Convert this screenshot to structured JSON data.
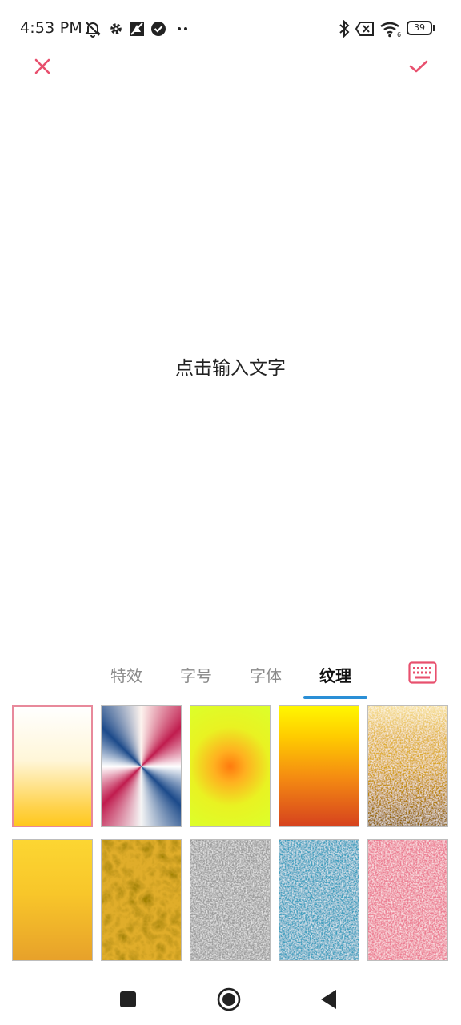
{
  "status_bar": {
    "time": "4:53 PM",
    "battery": "39",
    "icons": [
      "muted-bell-icon",
      "gear-icon",
      "sync-icon",
      "check-circle-icon",
      "more-dots-icon",
      "bluetooth-icon",
      "no-sim-icon",
      "wifi-icon",
      "battery-icon"
    ]
  },
  "header": {
    "close_icon": "close-icon",
    "confirm_icon": "check-icon",
    "accent_color": "#e8506e"
  },
  "canvas": {
    "placeholder": "点击输入文字"
  },
  "tabs": {
    "items": [
      {
        "label": "特效",
        "active": false
      },
      {
        "label": "字号",
        "active": false
      },
      {
        "label": "字体",
        "active": false
      },
      {
        "label": "纹理",
        "active": true
      }
    ],
    "indicator_color": "#2a8fd6",
    "keyboard_icon": "keyboard-icon"
  },
  "textures": [
    {
      "name": "cream-gold-gradient",
      "selected": true
    },
    {
      "name": "red-blue-radial-burst",
      "selected": false
    },
    {
      "name": "yellow-orange-radial",
      "selected": false
    },
    {
      "name": "yellow-red-gradient",
      "selected": false
    },
    {
      "name": "gold-glitter-stripes",
      "selected": false
    },
    {
      "name": "gold-gradient",
      "selected": false
    },
    {
      "name": "gold-foil",
      "selected": false
    },
    {
      "name": "silver-glitter",
      "selected": false
    },
    {
      "name": "blue-glitter",
      "selected": false
    },
    {
      "name": "pink-glitter",
      "selected": false
    }
  ],
  "nav_bar": {
    "icons": [
      "recents-square-icon",
      "home-circle-icon",
      "back-triangle-icon"
    ]
  }
}
